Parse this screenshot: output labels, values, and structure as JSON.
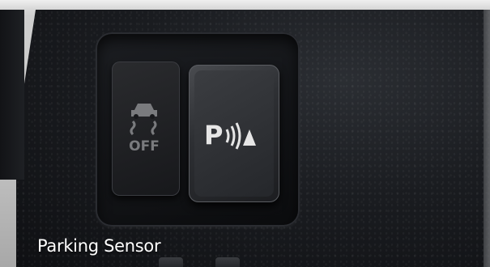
{
  "caption": {
    "text": "Parking Sensor"
  },
  "buttons": {
    "traction_control": {
      "label": "OFF",
      "icon": "traction-control-off-icon"
    },
    "parking_sensor": {
      "label": "P",
      "icon": "parking-sensor-icon"
    }
  },
  "colors": {
    "caption_text": "#ffffff",
    "icon_light": "#e6e6e6",
    "icon_dim": "#7a7b7e"
  }
}
